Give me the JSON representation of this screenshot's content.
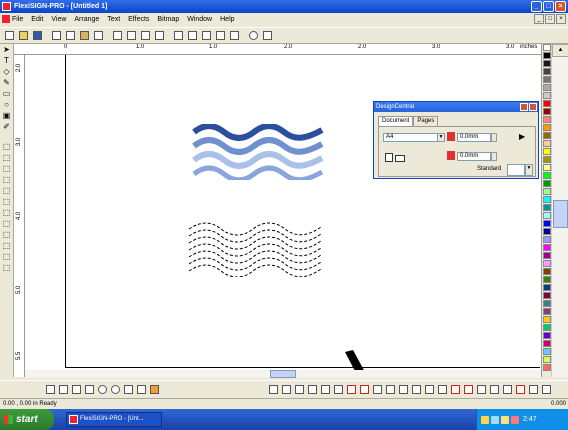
{
  "window": {
    "title": "FlexiSIGN-PRO - [Untitled 1]",
    "buttons": [
      "_",
      "□",
      "×"
    ]
  },
  "menu": [
    "File",
    "Edit",
    "View",
    "Arrange",
    "Text",
    "Effects",
    "Bitmap",
    "Window",
    "Help"
  ],
  "ruler": {
    "h_ticks": [
      "0",
      "1.0",
      "1.0",
      "2.0",
      "2.0",
      "3.0",
      "3.0",
      "inches"
    ],
    "v_ticks": [
      "2.0",
      "3.0",
      "4.0",
      "5.0",
      "5.5"
    ]
  },
  "design_central": {
    "title": "DesignCentral",
    "tabs": [
      "Document",
      "Pages"
    ],
    "page_size": "A4",
    "width_value": "0.0mm",
    "height_value": "0.0mm",
    "shadow_label": "Standard"
  },
  "status": {
    "left": "0.00 , 0.00 in   Ready",
    "right_value": "0.000"
  },
  "taskbar": {
    "start_label": "start",
    "task_item": "FlexiSIGN-PRO - [Unt...",
    "clock": "2:47"
  },
  "colors": {
    "wave_dark": "#2b4f9e",
    "wave_mid": "#6f8fcf",
    "wave_light": "#a9c0e9",
    "taskbar": "#2459c9",
    "start_green": "#3a8f3a"
  },
  "palette": [
    "#ffffff",
    "#000000",
    "#1a1a1a",
    "#444444",
    "#777777",
    "#aaaaaa",
    "#cccccc",
    "#ff0000",
    "#990000",
    "#ff8080",
    "#ff9900",
    "#996600",
    "#ffcc99",
    "#ffff00",
    "#999900",
    "#ffff99",
    "#00ff00",
    "#009900",
    "#99ff99",
    "#00ffff",
    "#009999",
    "#99ffff",
    "#0000ff",
    "#000099",
    "#9999ff",
    "#ff00ff",
    "#990099",
    "#ff99ff",
    "#804000",
    "#408000",
    "#004080",
    "#800040",
    "#408080",
    "#804080",
    "#ffcc00",
    "#00cc66",
    "#6600cc",
    "#cc0066",
    "#66ccff",
    "#ccff66",
    "#ff6666"
  ],
  "icons": {
    "tools": [
      "arrow",
      "text",
      "node",
      "shape",
      "rectangle",
      "ellipse",
      "fill",
      "eyedropper"
    ],
    "tray": [
      "speaker",
      "network",
      "update",
      "security"
    ]
  }
}
